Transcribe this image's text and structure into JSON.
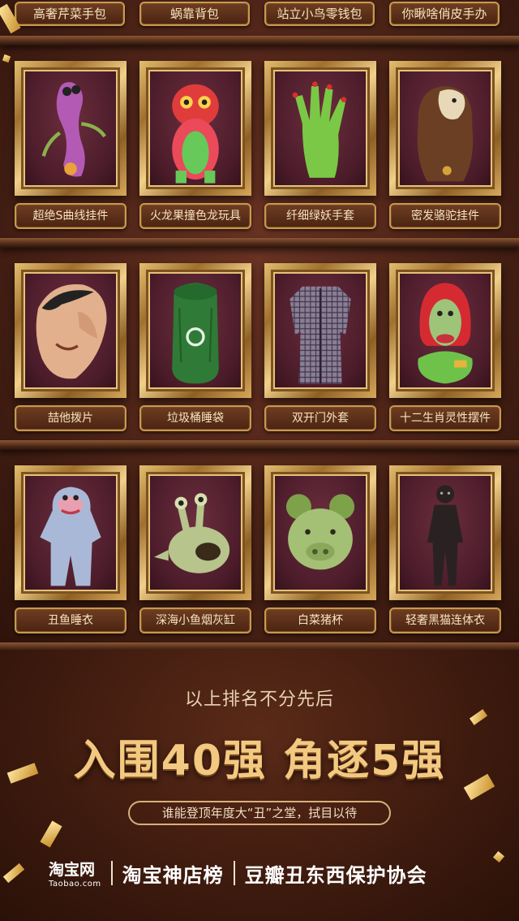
{
  "top_row": [
    "高奢芹菜手包",
    "蜗靠背包",
    "站立小鸟零钱包",
    "你瞅啥俏皮手办"
  ],
  "rows": [
    {
      "items": [
        {
          "label": "超绝S曲线挂件",
          "icon": "purple-figure-icon"
        },
        {
          "label": "火龙果撞色龙玩具",
          "icon": "chameleon-toy-icon"
        },
        {
          "label": "纤细绿妖手套",
          "icon": "green-glove-icon"
        },
        {
          "label": "密发骆驼挂件",
          "icon": "camel-plush-icon"
        }
      ]
    },
    {
      "items": [
        {
          "label": "喆他拨片",
          "icon": "face-pick-icon"
        },
        {
          "label": "垃圾桶睡袋",
          "icon": "trash-sleeping-bag-icon"
        },
        {
          "label": "双开门外套",
          "icon": "plaid-coat-icon"
        },
        {
          "label": "十二生肖灵性摆件",
          "icon": "zodiac-figurine-icon"
        }
      ]
    },
    {
      "items": [
        {
          "label": "丑鱼睡衣",
          "icon": "fish-pajama-icon"
        },
        {
          "label": "深海小鱼烟灰缸",
          "icon": "fish-ashtray-icon"
        },
        {
          "label": "白菜猪杯",
          "icon": "pig-cup-icon"
        },
        {
          "label": "轻奢黑猫连体衣",
          "icon": "black-cat-suit-icon"
        }
      ]
    }
  ],
  "footer": {
    "note": "以上排名不分先后",
    "headline": "入围40强 角逐5强",
    "tagline": "谁能登顶年度大“丑”之堂，拭目以待",
    "taobao_main": "淘宝网",
    "taobao_sub": "Taobao.com",
    "brand1": "淘宝神店榜",
    "brand2": "豆瓣丑东西保护协会"
  },
  "colors": {
    "gold": "#f3c981",
    "background": "#3a1a10",
    "label_bg": "#5a2e19",
    "frame_gold": "#d6a75a"
  }
}
